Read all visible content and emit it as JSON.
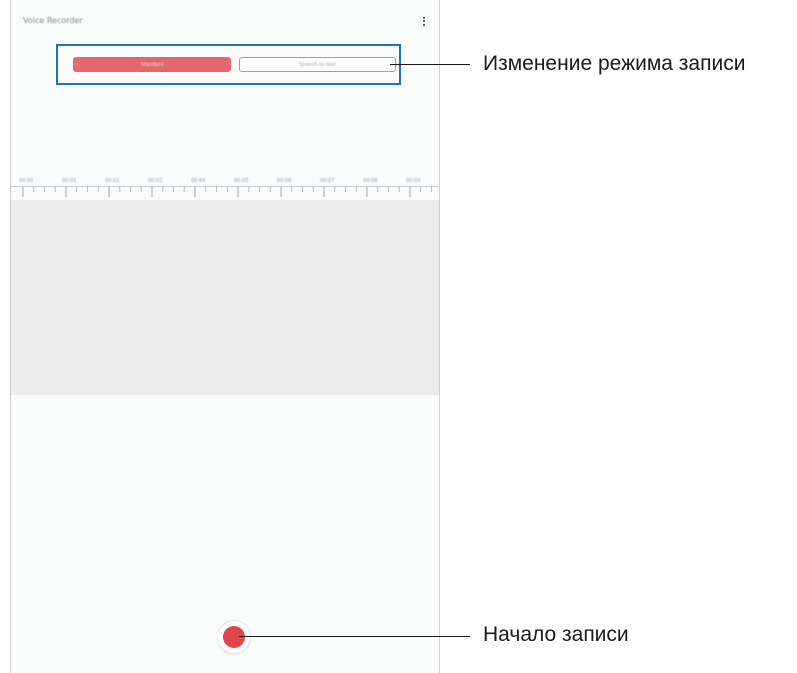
{
  "app": {
    "title": "Voice Recorder"
  },
  "modes": {
    "tabs": [
      {
        "label": "Standard",
        "selected": true
      },
      {
        "label": "Speech-to-text",
        "selected": false
      }
    ]
  },
  "timeline": {
    "labels": [
      "00:00",
      "00:01",
      "00:02",
      "00:03",
      "00:04",
      "00:05",
      "00:06",
      "00:07",
      "00:08",
      "00:09"
    ]
  },
  "icons": {
    "more": "more-vertical-icon",
    "record": "record-icon"
  },
  "colors": {
    "accent": "#e0454c",
    "active_tab": "#e2686d",
    "highlight": "#1c75bc"
  },
  "annotations": {
    "mode_change": "Изменение режима записи",
    "start_recording": "Начало записи"
  }
}
